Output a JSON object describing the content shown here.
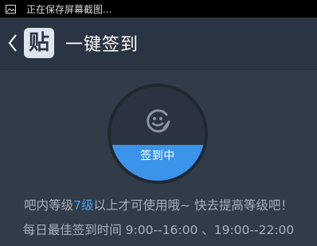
{
  "status_bar": {
    "text": "正在保存屏幕截图...",
    "icon": "image-icon"
  },
  "header": {
    "back_icon": "chevron-left-icon",
    "logo_text": "贴",
    "title": "一键签到"
  },
  "sign_button": {
    "label": "签到中",
    "icon": "smiley-edit-icon",
    "progress_fraction": 0.38,
    "fill_color": "#3a94ea"
  },
  "info": {
    "line1_prefix": "吧内等级",
    "line1_level": "7级",
    "line1_suffix": "以上才可使用哦~ 快去提高等级吧！",
    "line2": "每日最佳签到时间  9:00--16:00 、19:00--22:00"
  },
  "colors": {
    "background": "#323c49",
    "title_bar": "#2b3442",
    "highlight": "#4a9df0"
  }
}
